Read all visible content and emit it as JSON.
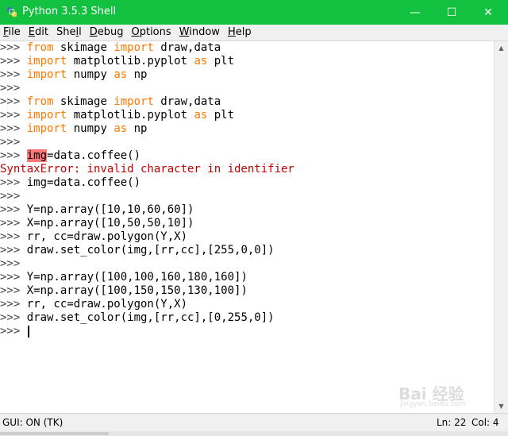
{
  "window": {
    "title": "Python 3.5.3 Shell",
    "icon": "python-icon",
    "controls": {
      "minimize": "—",
      "maximize": "☐",
      "close": "✕"
    },
    "accent": "#12c13f"
  },
  "menu": [
    {
      "label": "File",
      "underline": "F",
      "rest": "ile"
    },
    {
      "label": "Edit",
      "underline": "E",
      "rest": "dit"
    },
    {
      "label": "Shell",
      "pre": "She",
      "underline": "l",
      "rest": "l"
    },
    {
      "label": "Debug",
      "underline": "D",
      "rest": "ebug"
    },
    {
      "label": "Options",
      "underline": "O",
      "rest": "ptions"
    },
    {
      "label": "Window",
      "underline": "W",
      "rest": "indow"
    },
    {
      "label": "Help",
      "underline": "H",
      "rest": "elp"
    }
  ],
  "shell": {
    "lines": [
      [
        {
          "t": ">>> ",
          "c": "prompt"
        },
        {
          "t": "from",
          "c": "kw"
        },
        {
          "t": " skimage ",
          "c": "code"
        },
        {
          "t": "import",
          "c": "kw"
        },
        {
          "t": " draw,data",
          "c": "code"
        }
      ],
      [
        {
          "t": ">>> ",
          "c": "prompt"
        },
        {
          "t": "import",
          "c": "kw"
        },
        {
          "t": " matplotlib.pyplot ",
          "c": "code"
        },
        {
          "t": "as",
          "c": "kw"
        },
        {
          "t": " plt",
          "c": "code"
        }
      ],
      [
        {
          "t": ">>> ",
          "c": "prompt"
        },
        {
          "t": "import",
          "c": "kw"
        },
        {
          "t": " numpy ",
          "c": "code"
        },
        {
          "t": "as",
          "c": "kw"
        },
        {
          "t": " np",
          "c": "code"
        }
      ],
      [
        {
          "t": ">>>",
          "c": "prompt"
        }
      ],
      [
        {
          "t": ">>> ",
          "c": "prompt"
        },
        {
          "t": "from",
          "c": "kw"
        },
        {
          "t": " skimage ",
          "c": "code"
        },
        {
          "t": "import",
          "c": "kw"
        },
        {
          "t": " draw,data",
          "c": "code"
        }
      ],
      [
        {
          "t": ">>> ",
          "c": "prompt"
        },
        {
          "t": "import",
          "c": "kw"
        },
        {
          "t": " matplotlib.pyplot ",
          "c": "code"
        },
        {
          "t": "as",
          "c": "kw"
        },
        {
          "t": " plt",
          "c": "code"
        }
      ],
      [
        {
          "t": ">>> ",
          "c": "prompt"
        },
        {
          "t": "import",
          "c": "kw"
        },
        {
          "t": " numpy ",
          "c": "code"
        },
        {
          "t": "as",
          "c": "kw"
        },
        {
          "t": " np",
          "c": "code"
        }
      ],
      [
        {
          "t": ">>>",
          "c": "prompt"
        }
      ],
      [
        {
          "t": ">>> ",
          "c": "prompt"
        },
        {
          "t": "img",
          "c": "code hl"
        },
        {
          "t": "=data.coffee()",
          "c": "code"
        }
      ],
      [
        {
          "t": "SyntaxError: invalid character in identifier",
          "c": "err"
        }
      ],
      [
        {
          "t": ">>> ",
          "c": "prompt"
        },
        {
          "t": "img=data.coffee()",
          "c": "code"
        }
      ],
      [
        {
          "t": ">>>",
          "c": "prompt"
        }
      ],
      [
        {
          "t": ">>> ",
          "c": "prompt"
        },
        {
          "t": "Y=np.array([10,10,60,60])",
          "c": "code"
        }
      ],
      [
        {
          "t": ">>> ",
          "c": "prompt"
        },
        {
          "t": "X=np.array([10,50,50,10])",
          "c": "code"
        }
      ],
      [
        {
          "t": ">>> ",
          "c": "prompt"
        },
        {
          "t": "rr, cc=draw.polygon(Y,X)",
          "c": "code"
        }
      ],
      [
        {
          "t": ">>> ",
          "c": "prompt"
        },
        {
          "t": "draw.set_color(img,[rr,cc],[255,0,0])",
          "c": "code"
        }
      ],
      [
        {
          "t": ">>>",
          "c": "prompt"
        }
      ],
      [
        {
          "t": ">>> ",
          "c": "prompt"
        },
        {
          "t": "Y=np.array([100,100,160,180,160])",
          "c": "code"
        }
      ],
      [
        {
          "t": ">>> ",
          "c": "prompt"
        },
        {
          "t": "X=np.array([100,150,150,130,100])",
          "c": "code"
        }
      ],
      [
        {
          "t": ">>> ",
          "c": "prompt"
        },
        {
          "t": "rr, cc=draw.polygon(Y,X)",
          "c": "code"
        }
      ],
      [
        {
          "t": ">>> ",
          "c": "prompt"
        },
        {
          "t": "draw.set_color(img,[rr,cc],[0,255,0])",
          "c": "code"
        }
      ],
      [
        {
          "t": ">>> ",
          "c": "prompt"
        }
      ]
    ],
    "cursor_line": 21
  },
  "status": {
    "gui": "GUI: ON (TK)",
    "ln": "Ln: 22",
    "col": "Col: 4"
  },
  "watermark": {
    "text": "Bai 经验",
    "sub": "jingyan.baidu.com"
  },
  "colors": {
    "keyword": "#ff7700",
    "error": "#c00000",
    "highlight": "#ff7777"
  }
}
